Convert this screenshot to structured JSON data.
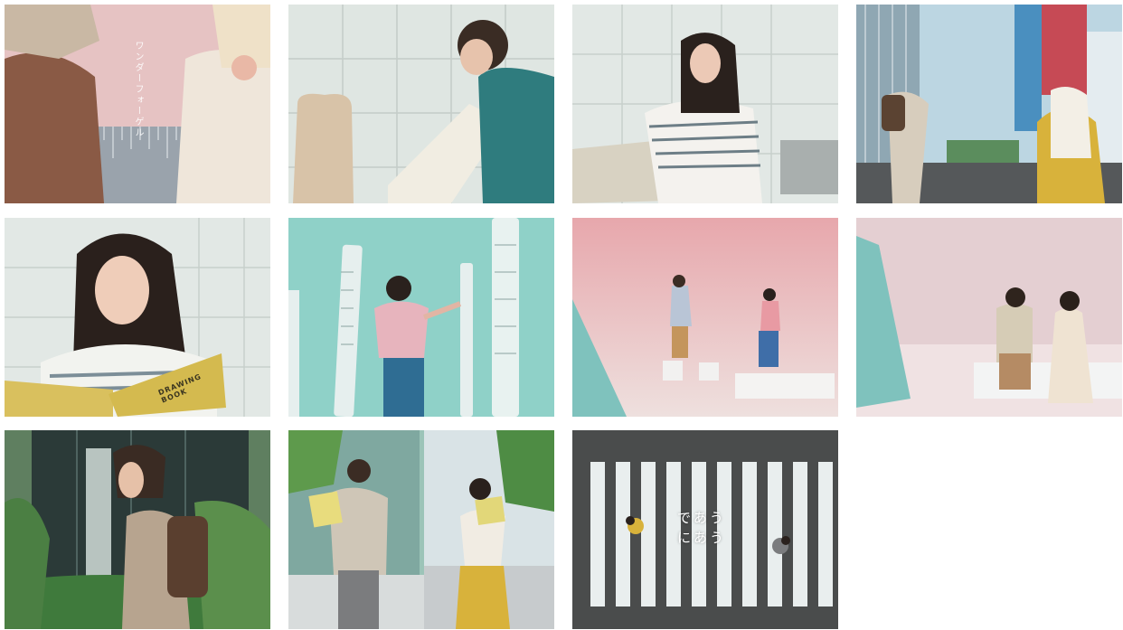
{
  "frames": [
    {
      "id": 1,
      "title_text": "ワンダーフォーゲル"
    },
    {
      "id": 2
    },
    {
      "id": 3
    },
    {
      "id": 4
    },
    {
      "id": 5,
      "book_text": "DRAWING BOOK"
    },
    {
      "id": 6
    },
    {
      "id": 7
    },
    {
      "id": 8
    },
    {
      "id": 9
    },
    {
      "id": 10
    },
    {
      "id": 11,
      "line1": "であう",
      "line2": "にあう"
    }
  ],
  "colors": {
    "pink_bg": "#e9c6c6",
    "mint_bg": "#8fd1c8",
    "tile_wall": "#dfe6e3",
    "asphalt": "#4a4c4c",
    "mustard": "#d8b23b",
    "teal_shirt": "#2f7c7e"
  }
}
